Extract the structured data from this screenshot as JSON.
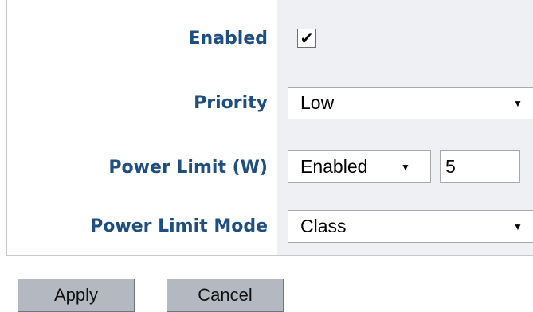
{
  "form": {
    "enabled": {
      "label": "Enabled",
      "checked": true,
      "check_glyph": "✔"
    },
    "priority": {
      "label": "Priority",
      "value": "Low"
    },
    "power_limit": {
      "label": "Power Limit (W)",
      "mode_value": "Enabled",
      "input_value": "5"
    },
    "power_limit_mode": {
      "label": "Power Limit Mode",
      "value": "Class"
    }
  },
  "buttons": {
    "apply": "Apply",
    "cancel": "Cancel"
  },
  "icons": {
    "dropdown_arrow": "▼"
  },
  "colors": {
    "label_text": "#1e4f7e",
    "value_column_bg": "#eef0f4",
    "button_bg": "#b3b8c1"
  }
}
